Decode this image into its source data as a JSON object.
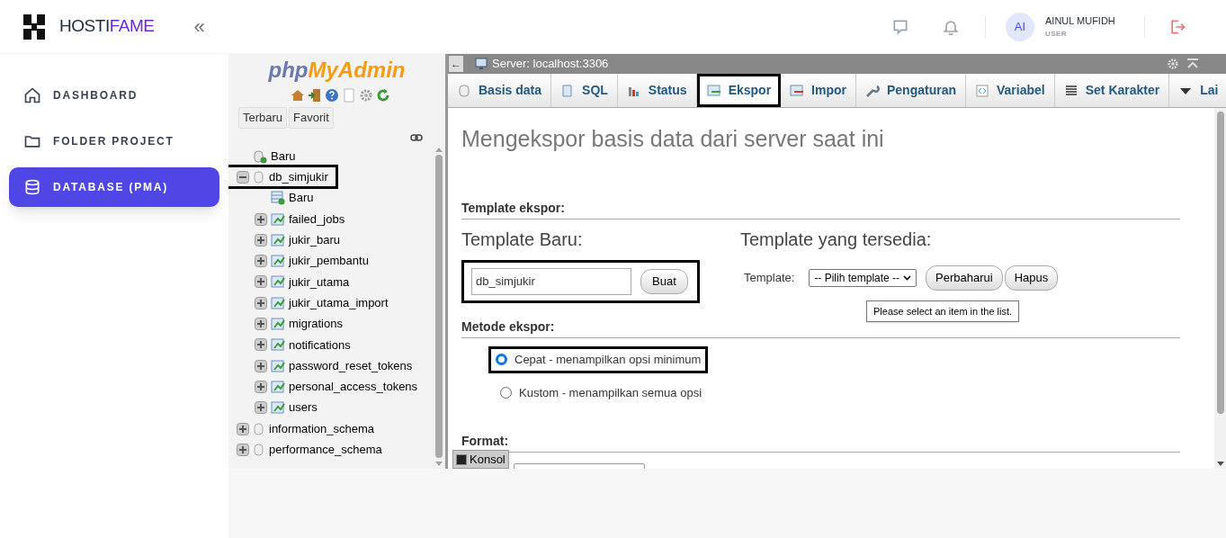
{
  "brand": {
    "name_part_1": "HOSTI",
    "name_part_2": "FAME",
    "collapse": "«"
  },
  "sidebar": {
    "items": [
      {
        "label": "DASHBOARD",
        "kind": "home",
        "selected": false
      },
      {
        "label": "FOLDER PROJECT",
        "kind": "folder",
        "selected": false
      },
      {
        "label": "DATABASE (PMA)",
        "kind": "database",
        "selected": true
      }
    ]
  },
  "user": {
    "initials": "AI",
    "name": "AINUL MUFIDH",
    "role": "USER"
  },
  "pma_nav": {
    "logo_part_1": "php",
    "logo_part_2": "MyAdmin",
    "buttons": [
      "Terbaru",
      "Favorit"
    ],
    "tree": [
      {
        "label": "Baru",
        "kind": "new",
        "highlighted": false
      },
      {
        "label": "db_simjukir",
        "kind": "database",
        "highlighted": true,
        "expanded": true,
        "children": [
          {
            "label": "Baru",
            "kind": "new-table"
          },
          {
            "label": "failed_jobs",
            "kind": "table",
            "expanded": false
          },
          {
            "label": "jukir_baru",
            "kind": "table",
            "expanded": false
          },
          {
            "label": "jukir_pembantu",
            "kind": "table",
            "expanded": false
          },
          {
            "label": "jukir_utama",
            "kind": "table",
            "expanded": false
          },
          {
            "label": "jukir_utama_import",
            "kind": "table",
            "expanded": false
          },
          {
            "label": "migrations",
            "kind": "table",
            "expanded": false
          },
          {
            "label": "notifications",
            "kind": "table",
            "expanded": false
          },
          {
            "label": "password_reset_tokens",
            "kind": "table",
            "expanded": false
          },
          {
            "label": "personal_access_tokens",
            "kind": "table",
            "expanded": false
          },
          {
            "label": "users",
            "kind": "table",
            "expanded": false
          }
        ]
      },
      {
        "label": "information_schema",
        "kind": "database",
        "highlighted": false,
        "expanded": false
      },
      {
        "label": "performance_schema",
        "kind": "database",
        "highlighted": false,
        "expanded": false
      }
    ]
  },
  "pma_main": {
    "server": "Server: localhost:3306",
    "back": "←",
    "tabs": [
      {
        "label": "Basis data",
        "selected": false
      },
      {
        "label": "SQL",
        "selected": false
      },
      {
        "label": "Status",
        "selected": false
      },
      {
        "label": "Ekspor",
        "selected": true
      },
      {
        "label": "Impor",
        "selected": false
      },
      {
        "label": "Pengaturan",
        "selected": false
      },
      {
        "label": "Variabel",
        "selected": false
      },
      {
        "label": "Set Karakter",
        "selected": false
      },
      {
        "label": "Lai",
        "selected": false
      }
    ],
    "heading": "Mengekspor basis data dari server saat ini",
    "template_section": "Template ekspor:",
    "new_template_heading": "Template Baru:",
    "new_template_value": "db_simjukir",
    "create_button": "Buat",
    "available_heading": "Template yang tersedia:",
    "template_label": "Template:",
    "template_select": "-- Pilih template --",
    "update_button": "Perbaharui",
    "delete_button": "Hapus",
    "tooltip": "Please select an item in the list.",
    "method_section": "Metode ekspor:",
    "methods": [
      {
        "label": "Cepat - menampilkan opsi minimum",
        "selected": true,
        "highlighted": true
      },
      {
        "label": "Kustom - menampilkan semua opsi",
        "selected": false,
        "highlighted": false
      }
    ],
    "format_section": "Format:",
    "console": "Konsol"
  }
}
